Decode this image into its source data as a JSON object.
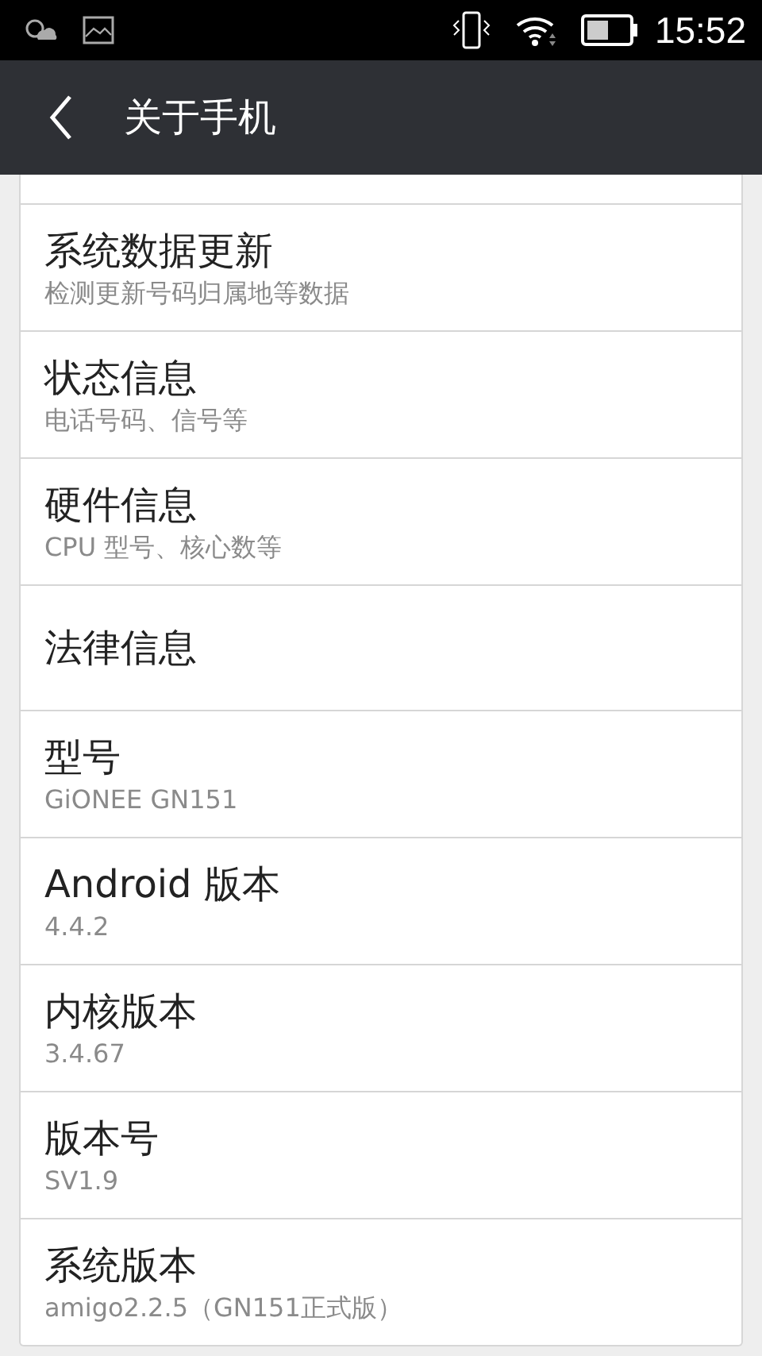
{
  "status_bar": {
    "time": "15:52"
  },
  "header": {
    "title": "关于手机"
  },
  "items": [
    {
      "title": "系统数据更新",
      "subtitle": "检测更新号码归属地等数据"
    },
    {
      "title": "状态信息",
      "subtitle": "电话号码、信号等"
    },
    {
      "title": "硬件信息",
      "subtitle": "CPU 型号、核心数等"
    },
    {
      "title": "法律信息"
    },
    {
      "title": "型号",
      "subtitle": "GiONEE GN151"
    },
    {
      "title": "Android 版本",
      "subtitle": "4.4.2"
    },
    {
      "title": "内核版本",
      "subtitle": "3.4.67"
    },
    {
      "title": "版本号",
      "subtitle": "SV1.9"
    },
    {
      "title": "系统版本",
      "subtitle": "amigo2.2.5（GN151正式版）"
    }
  ]
}
